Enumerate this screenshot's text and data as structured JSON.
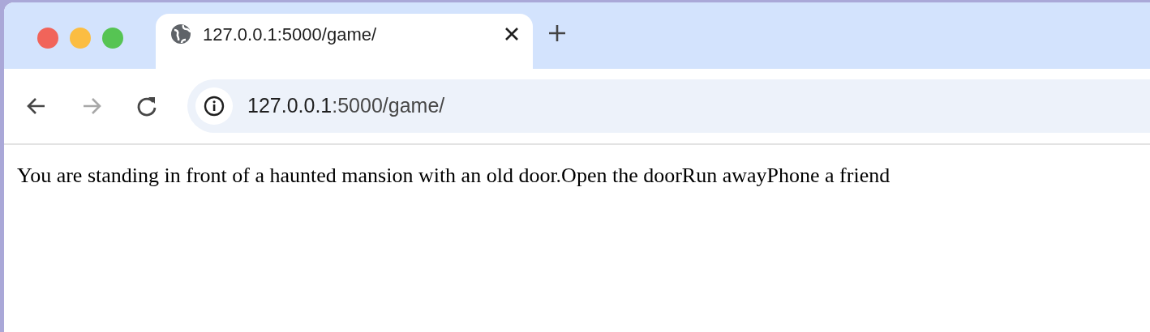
{
  "tabs": [
    {
      "title": "127.0.0.1:5000/game/",
      "selected": true
    }
  ],
  "toolbar": {
    "back_disabled": false,
    "forward_disabled": true
  },
  "address_bar": {
    "host": "127.0.0.1",
    "path": ":5000/game/"
  },
  "page": {
    "description": "You are standing in front of a haunted mansion with an old door.",
    "choices": [
      "Open the door",
      "Run away",
      "Phone a friend"
    ]
  }
}
